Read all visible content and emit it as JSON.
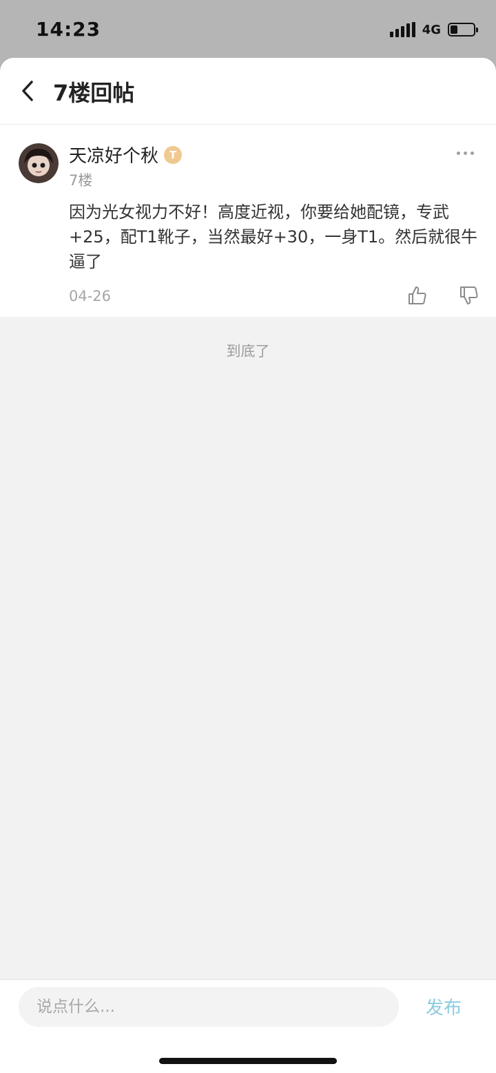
{
  "status_bar": {
    "time": "14:23",
    "network": "4G",
    "battery_level": 0.3
  },
  "nav": {
    "back_icon": "chevron-left-icon",
    "title": "7楼回帖"
  },
  "post": {
    "author": "天凉好个秋",
    "level_badge": "T",
    "floor": "7楼",
    "content": "因为光女视力不好！高度近视，你要给她配镜，专武+25，配T1靴子，当然最好+30，一身T1。然后就很牛逼了",
    "date": "04-26",
    "like_icon": "thumbs-up-icon",
    "dislike_icon": "thumbs-down-icon",
    "more_icon": "more-dots-icon"
  },
  "end_text": "到底了",
  "bottom_bar": {
    "input_placeholder": "说点什么...",
    "publish_label": "发布"
  },
  "colors": {
    "accent": "#8ccbde",
    "badge": "#f0c990"
  }
}
